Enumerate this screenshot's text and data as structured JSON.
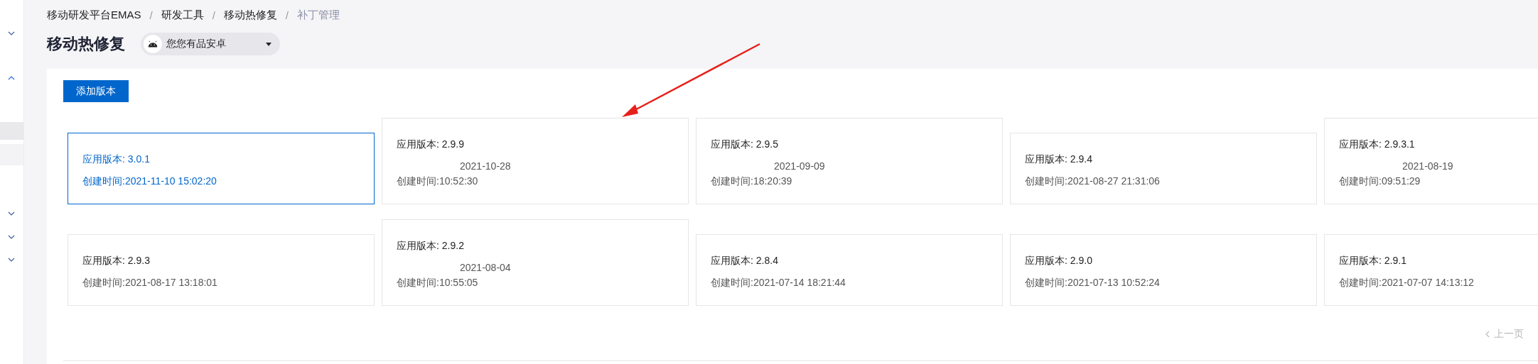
{
  "sidebar": {
    "items": [
      {
        "expanded": false
      },
      {
        "expanded": true
      },
      {
        "expanded": false
      },
      {
        "expanded": false
      },
      {
        "expanded": false
      }
    ]
  },
  "breadcrumb": [
    {
      "label": "移动研发平台EMAS",
      "current": false
    },
    {
      "label": "研发工具",
      "current": false
    },
    {
      "label": "移动热修复",
      "current": false
    },
    {
      "label": "补丁管理",
      "current": true
    }
  ],
  "breadcrumb_separator": "/",
  "page_title": "移动热修复",
  "app_selector": {
    "value": "您您有品安卓"
  },
  "add_button": "添加版本",
  "version_rows": [
    [
      {
        "version": "应用版本: 3.0.1",
        "created": [
          "创建时间:2021-11-10 15:02:20"
        ],
        "selected": true
      },
      {
        "version": "应用版本: 2.9.9",
        "created": [
          "2021-10-28",
          "创建时间:10:52:30"
        ],
        "selected": false
      },
      {
        "version": "应用版本: 2.9.5",
        "created": [
          "2021-09-09",
          "创建时间:18:20:39"
        ],
        "selected": false
      },
      {
        "version": "应用版本: 2.9.4",
        "created": [
          "创建时间:2021-08-27 21:31:06"
        ],
        "selected": false
      },
      {
        "version": "应用版本: 2.9.3.1",
        "created": [
          "2021-08-19",
          "创建时间:09:51:29"
        ],
        "selected": false
      }
    ],
    [
      {
        "version": "应用版本: 2.9.3",
        "created": [
          "创建时间:2021-08-17 13:18:01"
        ],
        "selected": false
      },
      {
        "version": "应用版本: 2.9.2",
        "created": [
          "2021-08-04",
          "创建时间:10:55:05"
        ],
        "selected": false
      },
      {
        "version": "应用版本: 2.8.4",
        "created": [
          "创建时间:2021-07-14 18:21:44"
        ],
        "selected": false
      },
      {
        "version": "应用版本: 2.9.0",
        "created": [
          "创建时间:2021-07-13 10:52:24"
        ],
        "selected": false
      },
      {
        "version": "应用版本: 2.9.1",
        "created": [
          "创建时间:2021-07-07 14:13:12"
        ],
        "selected": false
      }
    ]
  ],
  "pagination": {
    "prev": "上一页"
  }
}
